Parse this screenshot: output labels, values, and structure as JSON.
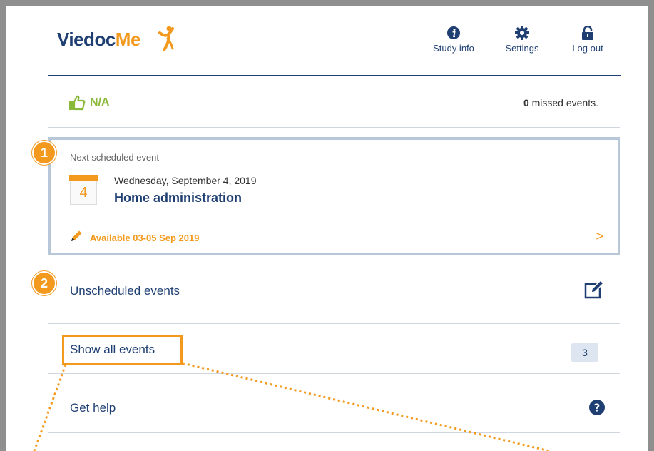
{
  "header": {
    "logo_text_1": "Viedoc",
    "logo_text_2": "Me",
    "nav": [
      {
        "label": "Study info",
        "icon": "info-icon"
      },
      {
        "label": "Settings",
        "icon": "gear-icon"
      },
      {
        "label": "Log out",
        "icon": "lock-icon"
      }
    ]
  },
  "status": {
    "compliance": "N/A",
    "missed_count": "0",
    "missed_text": " missed events."
  },
  "next_event": {
    "label": "Next scheduled event",
    "day": "4",
    "date": "Wednesday, September 4, 2019",
    "title": "Home administration",
    "availability": "Available 03-05 Sep 2019",
    "chevron": ">"
  },
  "unscheduled": {
    "label": "Unscheduled events"
  },
  "all_events": {
    "label": "Show all events",
    "count": "3"
  },
  "help": {
    "label": "Get help"
  },
  "callouts": [
    "1",
    "2"
  ],
  "colors": {
    "navy": "#1f3f73",
    "orange": "#f39a1e",
    "green": "#8ab83a",
    "frame": "#8f8f8f"
  }
}
